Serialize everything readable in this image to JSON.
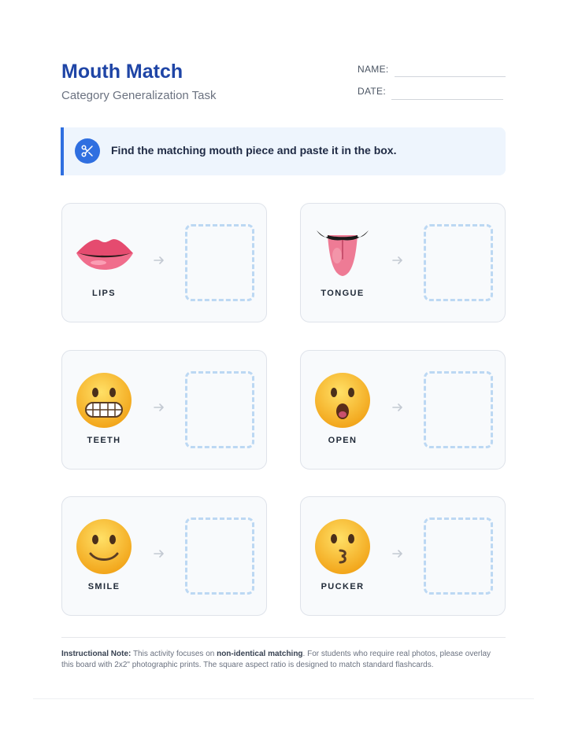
{
  "header": {
    "title": "Mouth Match",
    "subtitle": "Category Generalization Task",
    "name_label": "NAME:",
    "date_label": "DATE:"
  },
  "instruction": {
    "icon": "scissors-icon",
    "text": "Find the matching mouth piece and paste it in the box."
  },
  "cards": [
    {
      "label": "LIPS",
      "icon": "lips-emoji"
    },
    {
      "label": "TONGUE",
      "icon": "tongue-emoji"
    },
    {
      "label": "TEETH",
      "icon": "grimacing-face-emoji"
    },
    {
      "label": "OPEN",
      "icon": "open-mouth-face-emoji"
    },
    {
      "label": "SMILE",
      "icon": "slightly-smiling-face-emoji"
    },
    {
      "label": "PUCKER",
      "icon": "kissing-face-emoji"
    }
  ],
  "note": {
    "label": "Instructional Note:",
    "text_before": " This activity focuses on ",
    "emphasis": "non-identical matching",
    "text_after": ". For students who require real photos, please overlay this board with 2x2\" photographic prints. The square aspect ratio is designed to match standard flashcards."
  },
  "colors": {
    "title": "#1f45a6",
    "accent": "#2f6fe0",
    "banner_bg": "#eef5fd",
    "paste_box_border": "#bcd8f3",
    "emoji_yellow": "#f9c22e"
  }
}
